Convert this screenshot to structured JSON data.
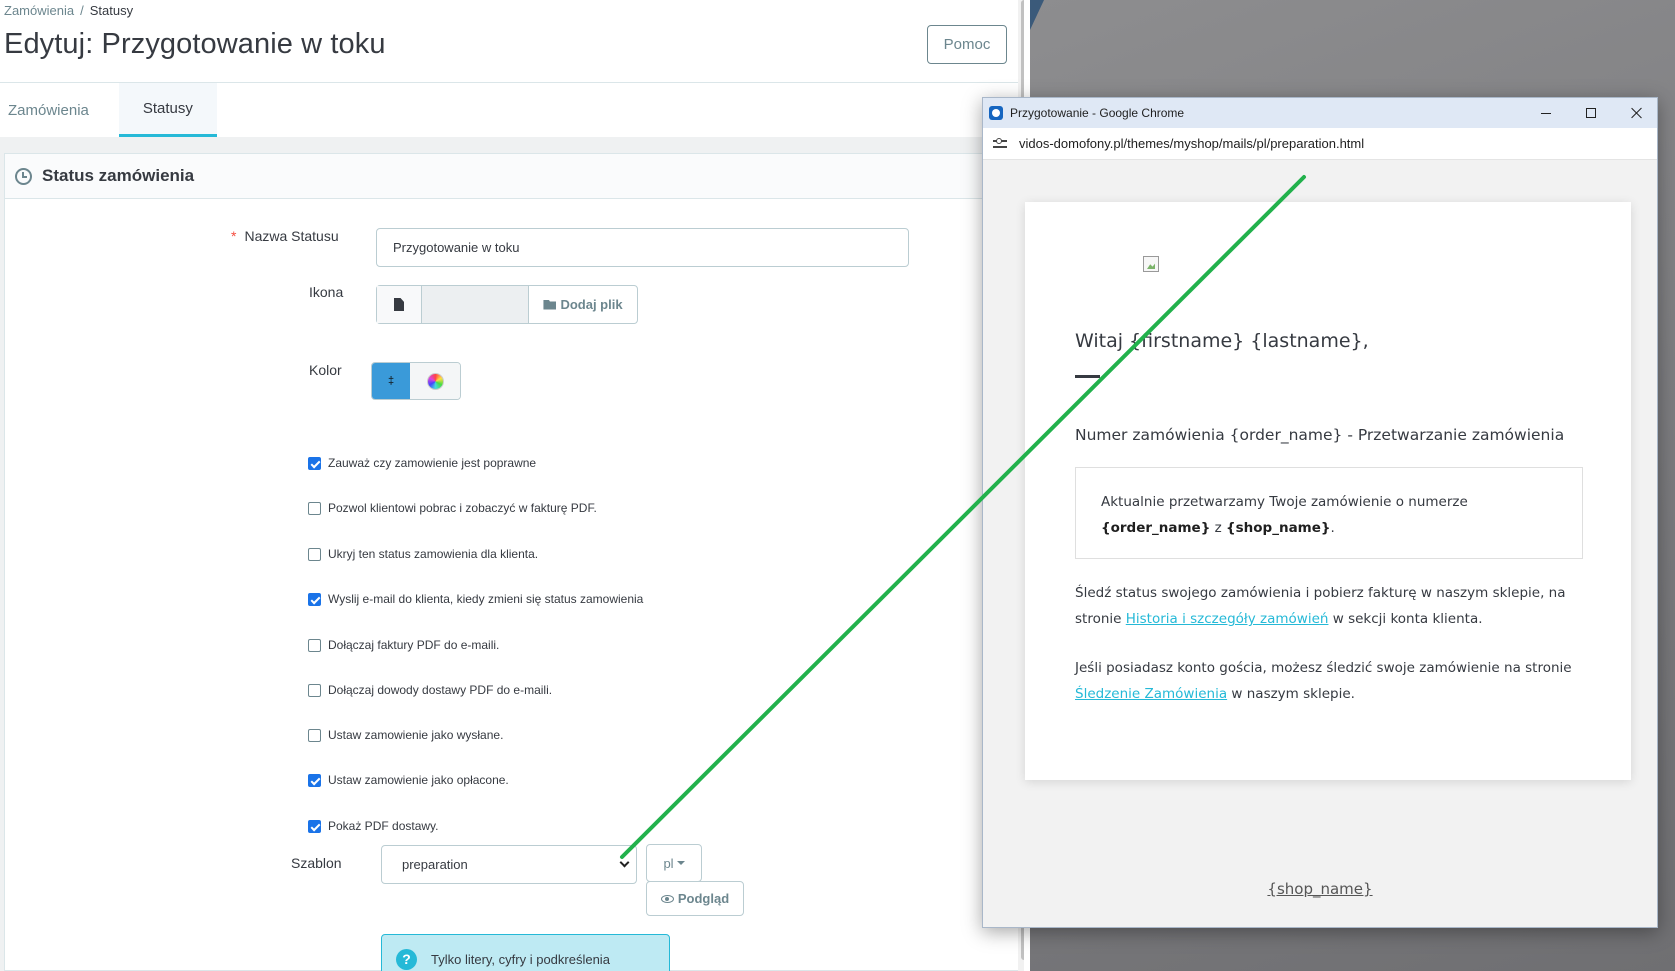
{
  "breadcrumb": {
    "parent": "Zamówienia",
    "current": "Statusy"
  },
  "page_title": "Edytuj: Przygotowanie w toku",
  "help_label": "Pomoc",
  "tabs": [
    {
      "label": "Zamówienia",
      "active": false
    },
    {
      "label": "Statusy",
      "active": true
    }
  ],
  "card_title": "Status zamówienia",
  "form": {
    "name_label": "Nazwa Statusu",
    "name_value": "Przygotowanie w toku",
    "icon_label": "Ikona",
    "add_file_label": "Dodaj plik",
    "color_label": "Kolor",
    "color_value": "#3a9ad9",
    "color_swatch_text": "‡",
    "checkboxes": [
      {
        "label": "Zauważ czy zamowienie jest poprawne",
        "checked": true
      },
      {
        "label": "Pozwol klientowi pobrac i zobaczyć w fakturę PDF.",
        "checked": false
      },
      {
        "label": "Ukryj ten status zamowienia dla klienta.",
        "checked": false
      },
      {
        "label": "Wyslij e-mail do klienta, kiedy zmieni się status zamowienia",
        "checked": true
      },
      {
        "label": "Dołączaj faktury PDF do e-maili.",
        "checked": false
      },
      {
        "label": "Dołączaj dowody dostawy PDF do e-maili.",
        "checked": false
      },
      {
        "label": "Ustaw zamowienie jako wysłane.",
        "checked": false
      },
      {
        "label": "Ustaw zamowienie jako opłacone.",
        "checked": true
      },
      {
        "label": "Pokaż PDF dostawy.",
        "checked": true
      }
    ],
    "template_label": "Szablon",
    "template_value": "preparation",
    "lang_value": "pl",
    "preview_label": "Podgląd",
    "info_text": "Tylko litery, cyfry i podkreślenia"
  },
  "chrome": {
    "title": "Przygotowanie - Google Chrome",
    "url": "vidos-domofony.pl/themes/myshop/mails/pl/preparation.html",
    "email": {
      "greeting": "Witaj {firstname} {lastname},",
      "order_heading": "Numer zamówienia {order_name} - Przetwarzanie zamówienia",
      "box_text_1": "Aktualnie przetwarzamy Twoje zamówienie o numerze",
      "box_order_name": "{order_name}",
      "box_z": "z",
      "box_shop_name": "{shop_name}",
      "box_dot": ".",
      "p1_before": "Śledź status swojego zamówienia i pobierz fakturę w naszym sklepie, na stronie",
      "p1_link": "Historia i szczegóły zamówień",
      "p1_after": "w sekcji konta klienta.",
      "p2_before": "Jeśli posiadasz konto gościa, możesz śledzić swoje zamówienie na stronie",
      "p2_link": "Śledzenie Zamówienia",
      "p2_after": "w naszym sklepie.",
      "footer": "{shop_name}"
    }
  },
  "annotation_color": "#22b14c"
}
